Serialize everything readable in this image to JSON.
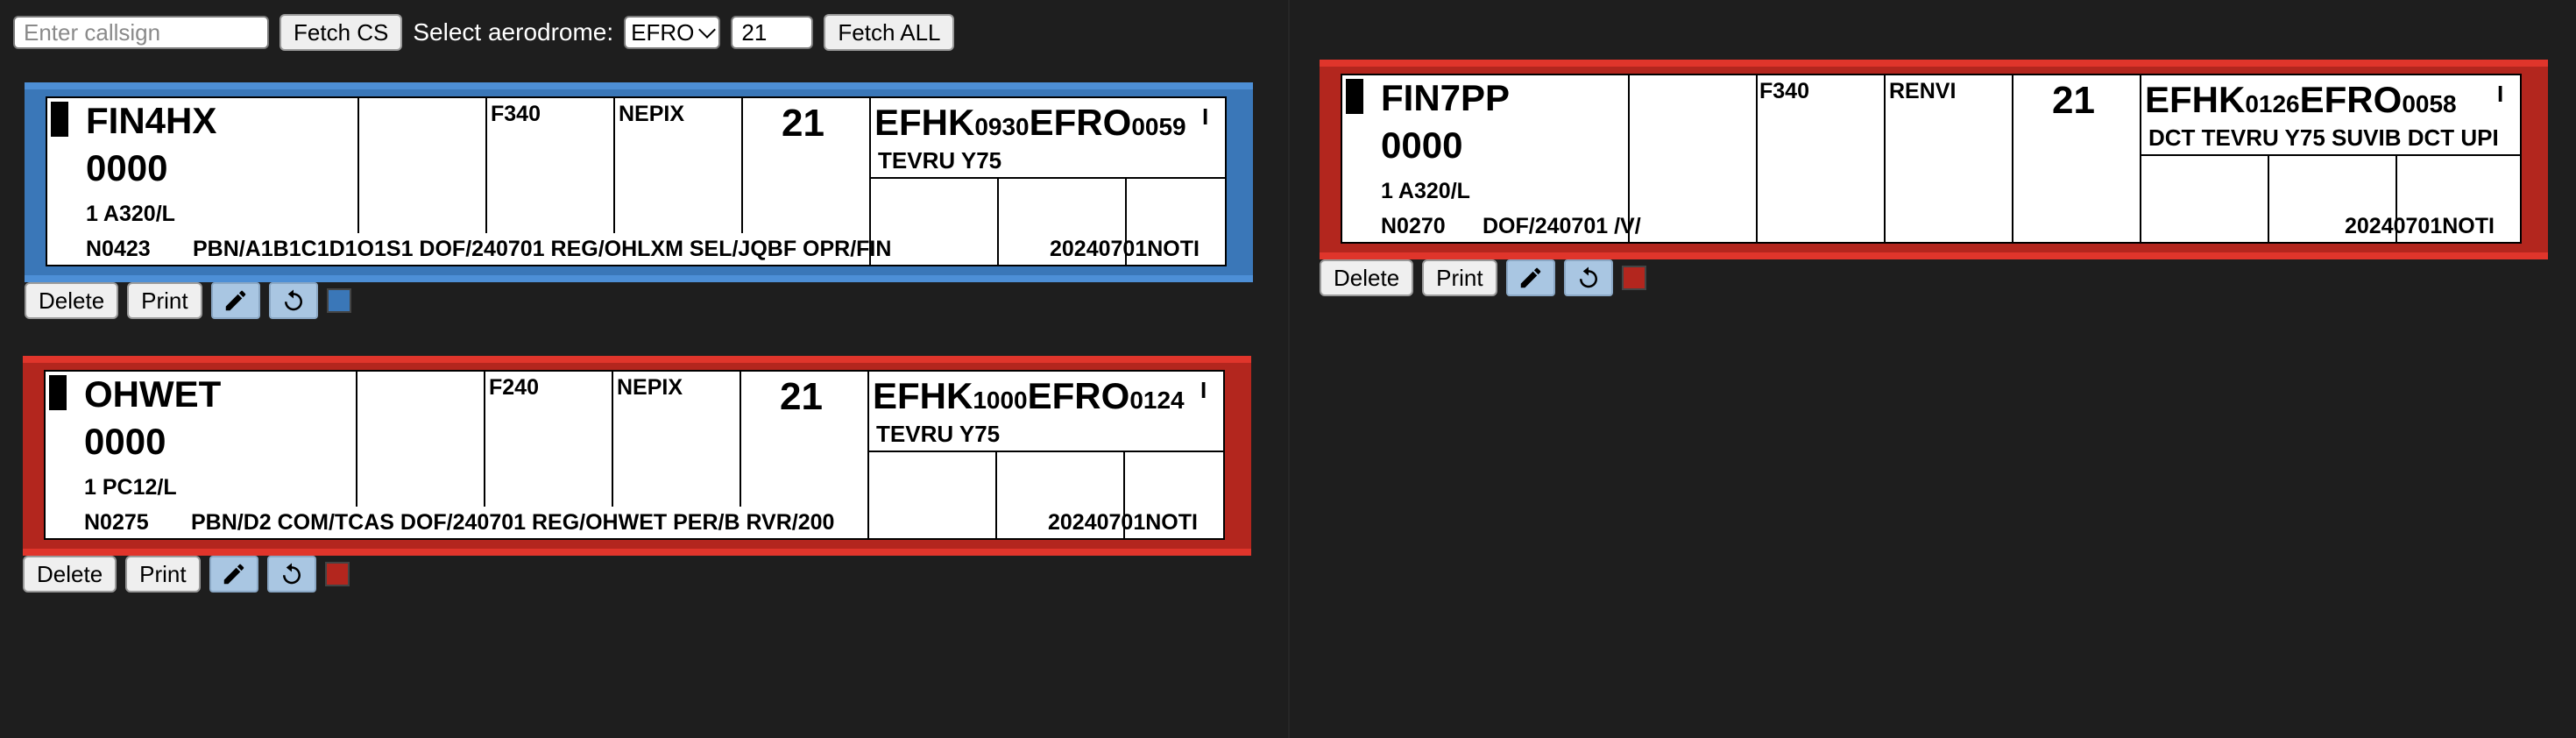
{
  "toolbar": {
    "callsign_placeholder": "Enter callsign",
    "fetch_cs_label": "Fetch CS",
    "aerodrome_label": "Select aerodrome:",
    "aerodrome_value": "EFRO",
    "runway_value": "21",
    "fetch_all_label": "Fetch ALL"
  },
  "strips": [
    {
      "color": "blue",
      "color_hex": "#3a77b8",
      "callsign": "FIN4HX",
      "squawk": "0000",
      "aircraft": "1 A320/L",
      "speed": "N0423",
      "remarks": "PBN/A1B1C1D1O1S1 DOF/240701 REG/OHLXM SEL/JQBF OPR/FIN",
      "level": "F340",
      "point": "NEPIX",
      "runway": "21",
      "dep": "EFHK",
      "dep_time": "0930",
      "arr": "EFRO",
      "arr_time": "0059",
      "flag": "I",
      "route": "TEVRU Y75",
      "trailer": "20240701NOTI"
    },
    {
      "color": "red",
      "color_hex": "#b3261e",
      "callsign": "OHWET",
      "squawk": "0000",
      "aircraft": "1 PC12/L",
      "speed": "N0275",
      "remarks": "PBN/D2 COM/TCAS DOF/240701 REG/OHWET PER/B RVR/200",
      "level": "F240",
      "point": "NEPIX",
      "runway": "21",
      "dep": "EFHK",
      "dep_time": "1000",
      "arr": "EFRO",
      "arr_time": "0124",
      "flag": "I",
      "route": "TEVRU Y75",
      "trailer": "20240701NOTI"
    },
    {
      "color": "red",
      "color_hex": "#b3261e",
      "callsign": "FIN7PP",
      "squawk": "0000",
      "aircraft": "1 A320/L",
      "speed": "N0270",
      "remarks": "DOF/240701 /V/",
      "level": "F340",
      "point": "RENVI",
      "runway": "21",
      "dep": "EFHK",
      "dep_time": "0126",
      "arr": "EFRO",
      "arr_time": "0058",
      "flag": "I",
      "route": "DCT TEVRU Y75 SUVIB DCT UPI",
      "trailer": "20240701NOTI"
    }
  ],
  "actions": {
    "delete_label": "Delete",
    "print_label": "Print",
    "edit_icon": "pencil-icon",
    "undo_icon": "undo-icon"
  }
}
